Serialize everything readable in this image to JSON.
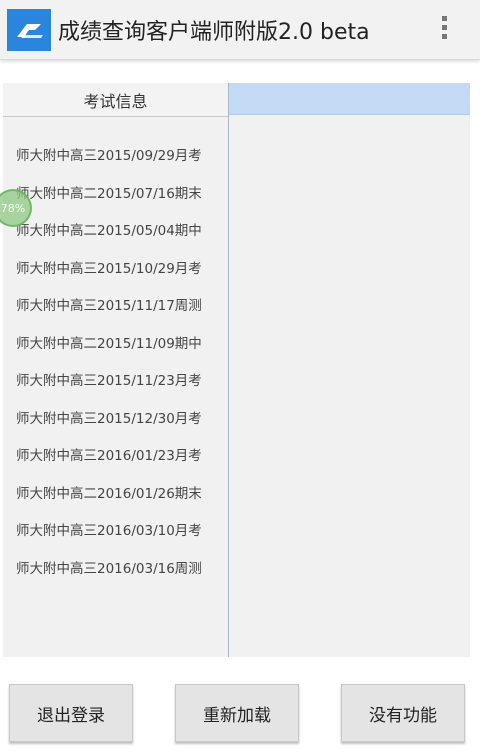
{
  "app": {
    "title": "成绩查询客户端师附版2.0 beta",
    "logo_icon": "app-logo-icon",
    "menu_icon": "overflow-menu-icon",
    "accent_color": "#2a86dd"
  },
  "left_panel": {
    "header": "考试信息",
    "exams": [
      "师大附中高三2015/09/29月考",
      "师大附中高二2015/07/16期末",
      "师大附中高二2015/05/04期中",
      "师大附中高三2015/10/29月考",
      "师大附中高三2015/11/17周测",
      "师大附中高二2015/11/09期中",
      "师大附中高三2015/11/23月考",
      "师大附中高三2015/12/30月考",
      "师大附中高三2016/01/23月考",
      "师大附中高二2016/01/26期末",
      "师大附中高三2016/03/10月考",
      "师大附中高三2016/03/16周测"
    ]
  },
  "right_panel": {
    "header_color": "#c4dbf6"
  },
  "overlay": {
    "progress_label": "78%",
    "progress_value": 0.78
  },
  "buttons": {
    "logout": "退出登录",
    "reload": "重新加载",
    "no_function": "没有功能"
  }
}
